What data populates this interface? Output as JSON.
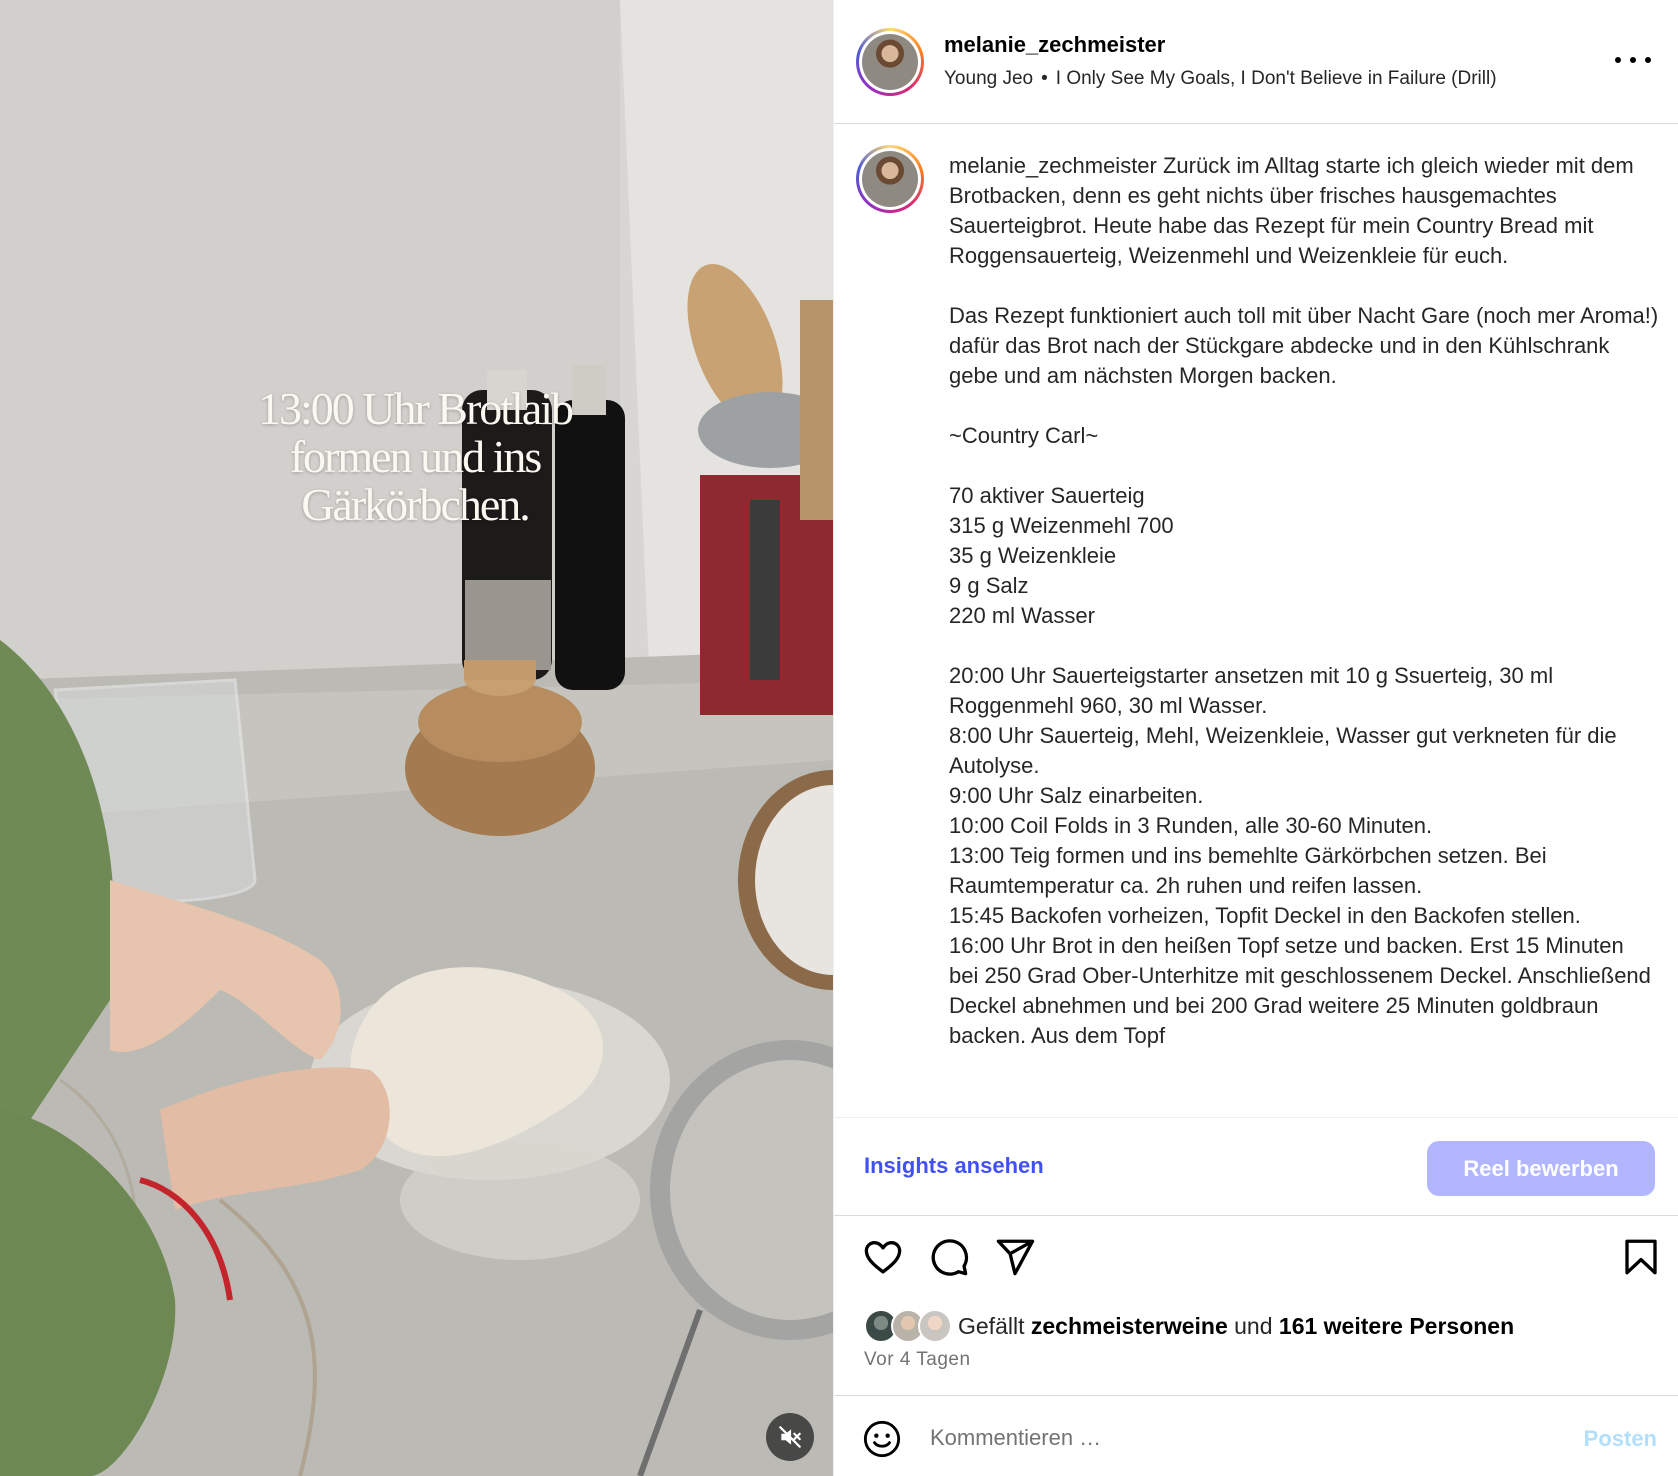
{
  "post": {
    "username": "melanie_zechmeister",
    "audio_artist": "Young Jeo",
    "audio_separator": "•",
    "audio_title": "I Only See My Goals, I Don't Believe in Failure (Drill)"
  },
  "video": {
    "overlay_line1": "13:00 Uhr Brotlaib",
    "overlay_line2": "formen und ins",
    "overlay_line3": "Gärkörbchen."
  },
  "caption": {
    "author": "melanie_zechmeister",
    "paragraphs": [
      " Zurück im Alltag starte ich gleich wieder mit dem Brotbacken, denn es geht nichts über frisches hausgemachtes Sauerteigbrot. Heute habe das Rezept für mein Country Bread mit Roggensauerteig, Weizenmehl und Weizenkleie für euch.",
      "",
      "Das Rezept funktioniert auch toll mit über Nacht Gare (noch mer Aroma!) dafür das Brot nach der Stückgare abdecke und in den Kühlschrank gebe und am nächsten Morgen backen.",
      "",
      "~Country Carl~",
      "",
      "70 aktiver Sauerteig",
      "315 g Weizenmehl 700",
      "35 g Weizenkleie",
      "9 g Salz",
      "220 ml Wasser",
      "",
      "20:00 Uhr Sauerteigstarter ansetzen mit 10 g Ssuerteig, 30 ml Roggenmehl 960, 30 ml Wasser.",
      "8:00 Uhr Sauerteig, Mehl, Weizenkleie, Wasser gut verkneten für die Autolyse.",
      "9:00 Uhr Salz einarbeiten.",
      "10:00 Coil Folds in 3 Runden, alle 30-60 Minuten.",
      "13:00 Teig formen und ins bemehlte Gärkörbchen setzen. Bei Raumtemperatur ca. 2h ruhen und reifen lassen.",
      "15:45 Backofen vorheizen, Topfit Deckel in den Backofen stellen.",
      "16:00 Uhr Brot in den heißen Topf setze und backen. Erst 15 Minuten bei 250 Grad Ober-Unterhitze mit geschlossenem Deckel. Anschließend Deckel abnehmen und bei 200 Grad weitere 25 Minuten goldbraun backen. Aus dem Topf"
    ]
  },
  "actions": {
    "insights_label": "Insights ansehen",
    "promote_label": "Reel bewerben"
  },
  "likes": {
    "prefix": "Gefällt ",
    "user": "zechmeisterweine",
    "middle": " und ",
    "count_text": "161 weitere Personen"
  },
  "timestamp": "Vor 4 Tagen",
  "comment": {
    "placeholder": "Kommentieren …",
    "post_label": "Posten"
  },
  "colors": {
    "link_blue": "#4150f7",
    "promote_bg": "#b2b6ff",
    "post_disabled": "#b2dffc"
  },
  "icons": [
    "mute-icon",
    "more-icon",
    "heart-icon",
    "comment-icon",
    "share-icon",
    "bookmark-icon",
    "emoji-icon"
  ]
}
